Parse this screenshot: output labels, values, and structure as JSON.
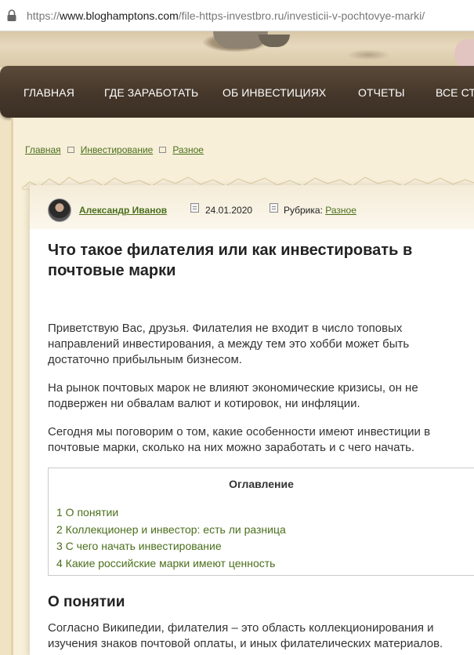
{
  "browser": {
    "url_scheme": "https://",
    "url_host": "www.bloghamptons.com",
    "url_path": "/file-https-investbro.ru/investicii-v-pochtovye-marki/"
  },
  "nav": {
    "items": [
      "ГЛАВНАЯ",
      "ГДЕ ЗАРАБОТАТЬ",
      "ОБ ИНВЕСТИЦИЯХ",
      "ОТЧЕТЫ",
      "ВСЕ СТ"
    ]
  },
  "breadcrumb": [
    "Главная",
    "Инвестирование",
    "Разное"
  ],
  "meta": {
    "author": "Александр Иванов",
    "date": "24.01.2020",
    "rubric_label": "Рубрика:",
    "rubric_value": "Разное"
  },
  "article": {
    "title": "Что такое филателия или как инвестировать в почтовые марки",
    "paragraphs": [
      "Приветствую Вас, друзья. Филателия не входит в число топовых направлений инвестирования, а между тем это хобби может быть достаточно прибыльным бизнесом.",
      "На рынок почтовых марок не влияют экономические кризисы, он не подвержен ни обвалам валют и котировок, ни инфляции.",
      "Сегодня мы поговорим о том, какие особенности имеют инвестиции в почтовые марки, сколько на них можно заработать и с чего начать."
    ],
    "toc": {
      "title": "Оглавление",
      "items": [
        "1 О понятии",
        "2 Коллекционер и инвестор: есть ли разница",
        "3 С чего начать инвестирование",
        "4 Какие российские марки имеют ценность"
      ]
    },
    "section_heading": "О понятии",
    "section_text": "Согласно Википедии, филателия – это область коллекционирования и изучения знаков почтовой оплаты, и иных филателических материалов."
  },
  "colors": {
    "link": "#4b6f1c",
    "nav_bg": "#45372a",
    "parchment": "#f7efd8"
  }
}
